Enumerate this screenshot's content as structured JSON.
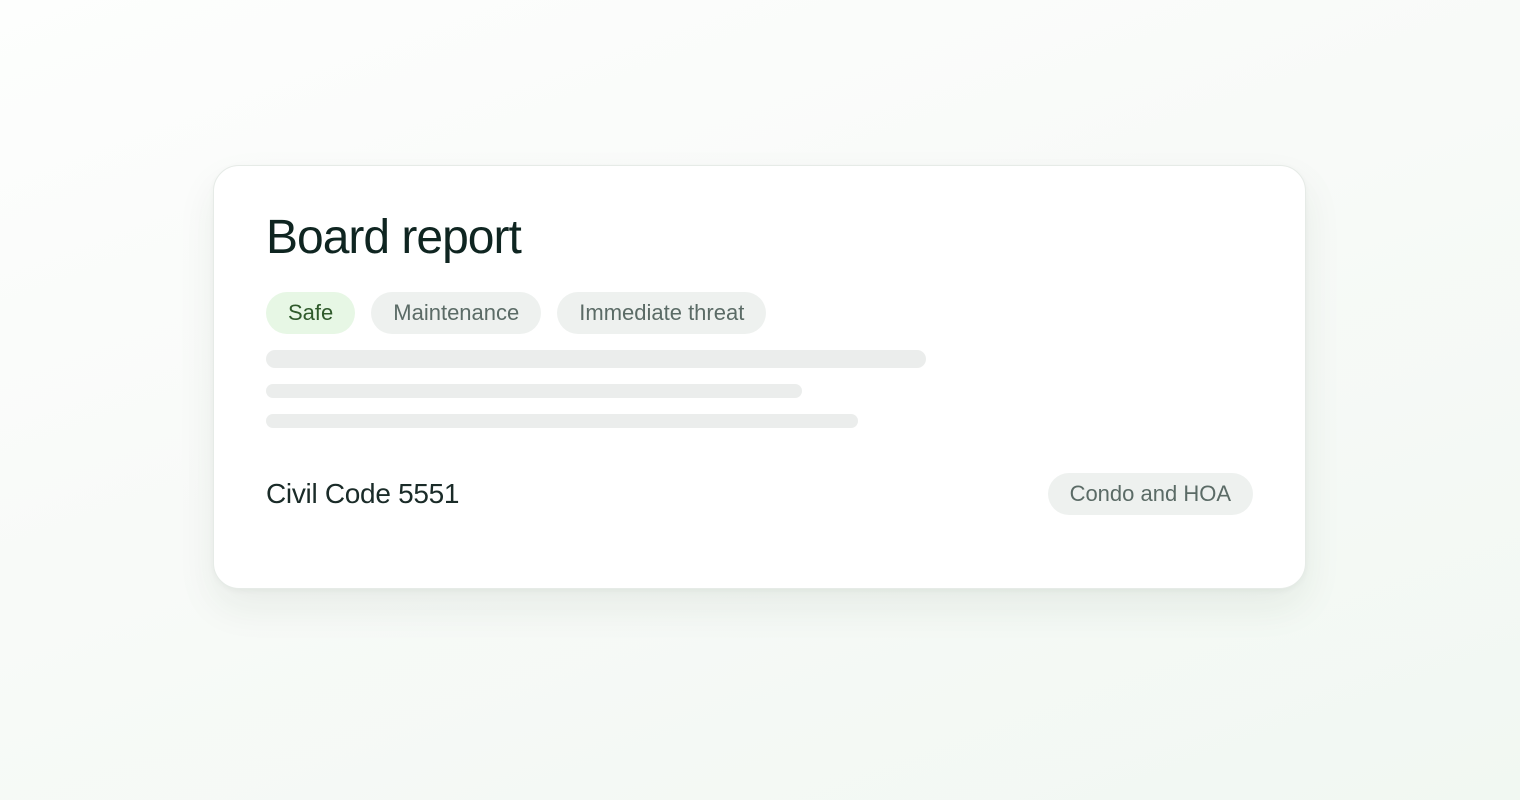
{
  "card": {
    "title": "Board report",
    "chips": [
      "Safe",
      "Maintenance",
      "Immediate threat"
    ],
    "reference": "Civil Code 5551",
    "category_tag": "Condo and HOA"
  },
  "colors": {
    "title": "#0f2521",
    "safe_chip_bg": "#e7f7e5",
    "safe_chip_text": "#2f5a2b",
    "chip_bg": "#eef1ef",
    "chip_text": "#5b6b66",
    "skeleton": "#ebedec"
  }
}
